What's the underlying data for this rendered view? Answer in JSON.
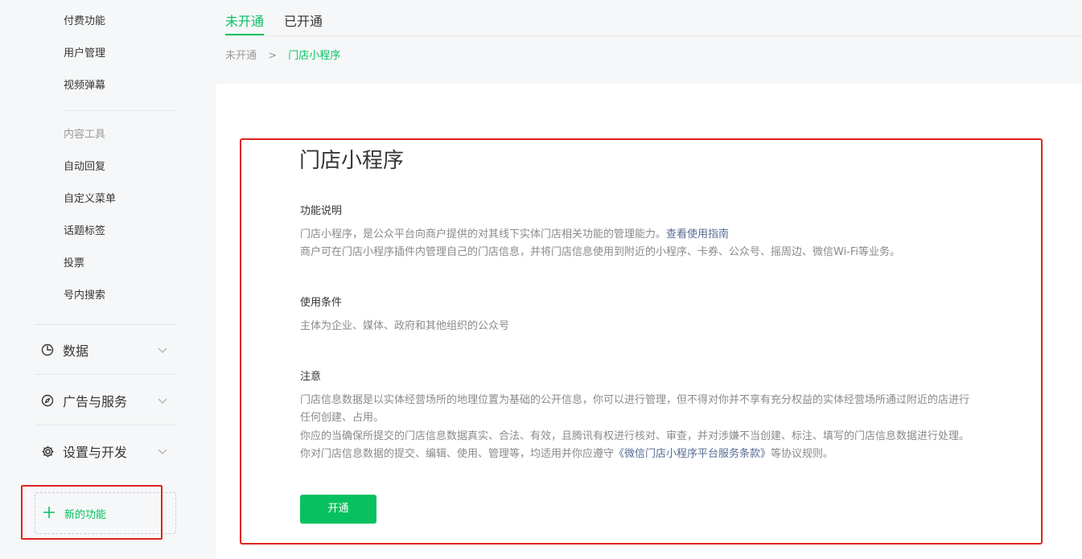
{
  "sidebar": {
    "top_items": [
      "付费功能",
      "用户管理",
      "视频弹幕"
    ],
    "content_tools_heading": "内容工具",
    "content_tools": [
      "自动回复",
      "自定义菜单",
      "话题标签",
      "投票",
      "号内搜索"
    ],
    "groups": [
      {
        "label": "数据",
        "icon": "pie-chart-icon"
      },
      {
        "label": "广告与服务",
        "icon": "compass-icon"
      },
      {
        "label": "设置与开发",
        "icon": "gear-icon"
      }
    ],
    "new_feature": {
      "label": "新的功能",
      "icon": "plus-icon"
    }
  },
  "tabs": [
    {
      "label": "未开通",
      "active": true
    },
    {
      "label": "已开通",
      "active": false
    }
  ],
  "breadcrumb": {
    "root": "未开通",
    "separator": ">",
    "current": "门店小程序"
  },
  "main": {
    "title": "门店小程序",
    "feature_desc": {
      "heading": "功能说明",
      "line1": "门店小程序，是公众平台向商户提供的对其线下实体门店相关功能的管理能力。",
      "line1_link": "查看使用指南",
      "line2": "商户可在门店小程序插件内管理自己的门店信息，并将门店信息使用到附近的小程序、卡券、公众号、摇周边、微信Wi-Fi等业务。"
    },
    "conditions": {
      "heading": "使用条件",
      "text": "主体为企业、媒体、政府和其他组织的公众号"
    },
    "notice": {
      "heading": "注意",
      "line1": "门店信息数据是以实体经营场所的地理位置为基础的公开信息，你可以进行管理，但不得对你并不享有充分权益的实体经营场所通过附近的店进行",
      "line2": "任何创建、占用。",
      "line3": "你应的当确保所提交的门店信息数据真实、合法、有效，且腾讯有权进行核对、审查，并对涉嫌不当创建、标注、填写的门店信息数据进行处理。",
      "line4_pre": "你对门店信息数据的提交、编辑、使用、管理等，均适用并你应遵守",
      "line4_link": "《微信门店小程序平台服务条款》",
      "line4_post": "等协议规则。"
    },
    "open_button": "开通"
  },
  "colors": {
    "accent": "#07c160",
    "link": "#576b95",
    "highlight_box": "#e0231e",
    "sidebar_bg": "#f6f7f8"
  }
}
